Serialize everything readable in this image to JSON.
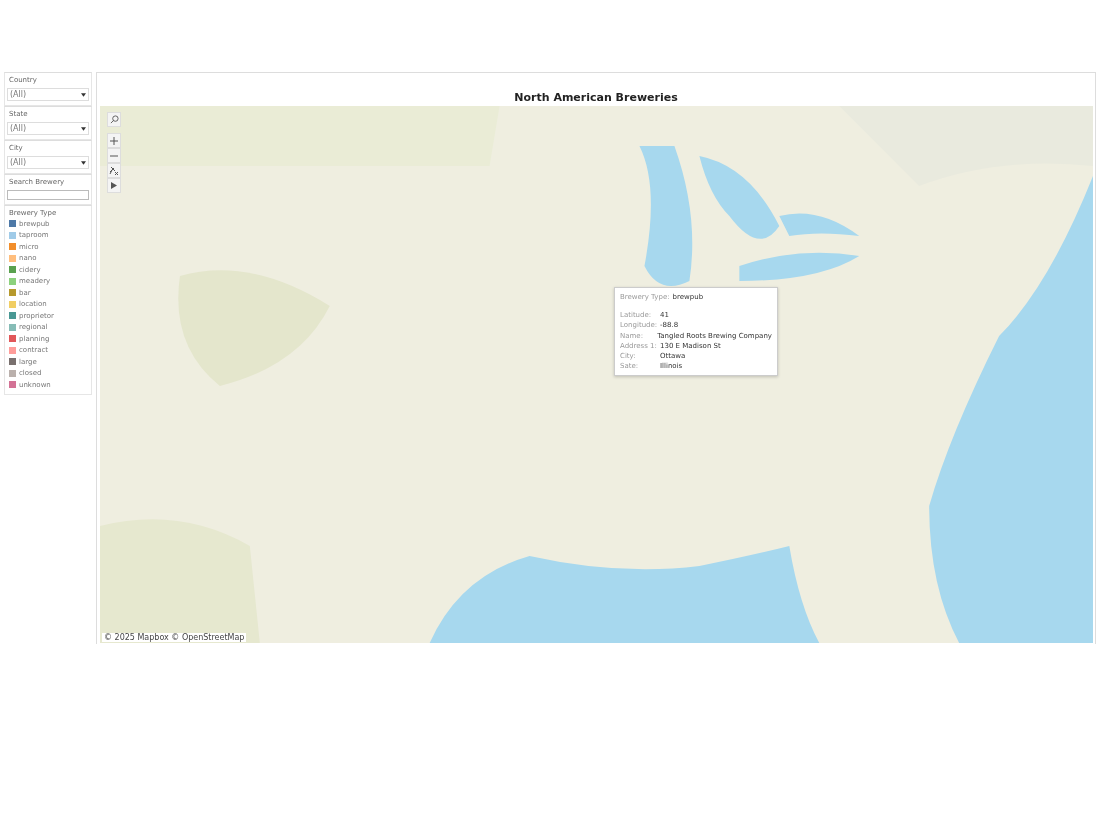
{
  "filters": [
    {
      "label": "Country",
      "kind": "dropdown",
      "value": "(All)"
    },
    {
      "label": "State",
      "kind": "dropdown",
      "value": "(All)"
    },
    {
      "label": "City",
      "kind": "dropdown",
      "value": "(All)"
    },
    {
      "label": "Search Brewery",
      "kind": "search"
    }
  ],
  "legend": {
    "title": "Brewery Type",
    "items": [
      {
        "label": "brewpub",
        "color": "#4e79a7"
      },
      {
        "label": "taproom",
        "color": "#a0cbe8"
      },
      {
        "label": "micro",
        "color": "#f28e2b"
      },
      {
        "label": "nano",
        "color": "#ffbe7d"
      },
      {
        "label": "cidery",
        "color": "#59a14f"
      },
      {
        "label": "meadery",
        "color": "#8cd17d"
      },
      {
        "label": "bar",
        "color": "#b6992d"
      },
      {
        "label": "location",
        "color": "#f1ce63"
      },
      {
        "label": "proprietor",
        "color": "#499894"
      },
      {
        "label": "regional",
        "color": "#86bcb6"
      },
      {
        "label": "planning",
        "color": "#e15759"
      },
      {
        "label": "contract",
        "color": "#ff9d9a"
      },
      {
        "label": "large",
        "color": "#79706e"
      },
      {
        "label": "closed",
        "color": "#bab0ac"
      },
      {
        "label": "unknown",
        "color": "#d37295"
      }
    ]
  },
  "title": "North American Breweries",
  "tooltip": {
    "header_label": "Brewery Type:",
    "header_value": "brewpub",
    "rows": [
      {
        "label": "Latitude:",
        "value": "41"
      },
      {
        "label": "Longitude:",
        "value": "-88.8"
      },
      {
        "label": "Name:",
        "value": "Tangled Roots Brewing Company"
      },
      {
        "label": "Address 1:",
        "value": "130 E Madison St"
      },
      {
        "label": "City:",
        "value": "Ottawa"
      },
      {
        "label": "Sate:",
        "value": "Illinois"
      }
    ]
  },
  "map_attribution": "© 2025 Mapbox © OpenStreetMap"
}
